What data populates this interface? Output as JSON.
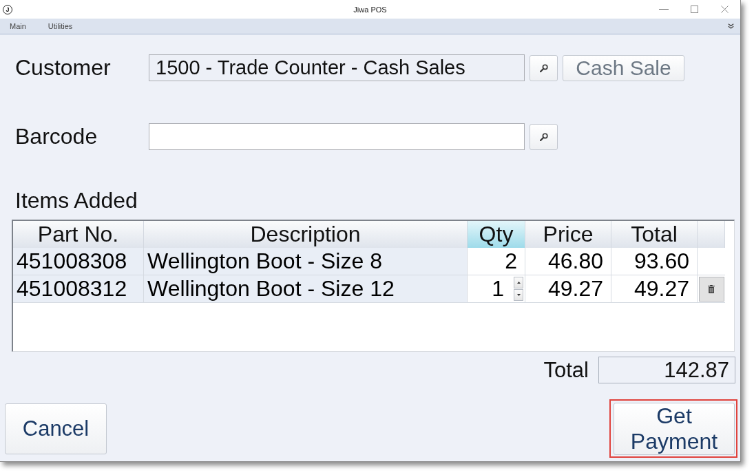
{
  "window": {
    "logo": "J",
    "title": "Jiwa POS"
  },
  "menu": [
    {
      "label": "Main"
    },
    {
      "label": "Utilities"
    }
  ],
  "customer": {
    "label": "Customer",
    "value": "1500 - Trade Counter - Cash Sales",
    "button": {
      "label": "Cash Sale",
      "disabled": true
    }
  },
  "barcode": {
    "label": "Barcode"
  },
  "items": {
    "label": "Items Added",
    "columns": [
      {
        "label": "Part No.",
        "kind": "text",
        "selected": false
      },
      {
        "label": "Description",
        "kind": "text",
        "selected": false
      },
      {
        "label": "Qty",
        "kind": "quantity",
        "selected": true
      },
      {
        "label": "Price",
        "kind": "number",
        "selected": false
      },
      {
        "label": "Total",
        "kind": "number",
        "selected": false
      }
    ],
    "rows": [
      {
        "cells": [
          "451008308",
          "Wellington Boot - Size 8",
          "2",
          "46.80",
          "93.60"
        ],
        "current": false
      },
      {
        "cells": [
          "451008312",
          "Wellington Boot - Size 12",
          "1",
          "49.27",
          "49.27"
        ],
        "current": true
      }
    ]
  },
  "total": {
    "label": "Total",
    "value": "142.87"
  },
  "actions": [
    {
      "label": "Cancel",
      "highlighted": false
    },
    {
      "label": "Get Payment",
      "highlighted": true
    }
  ]
}
